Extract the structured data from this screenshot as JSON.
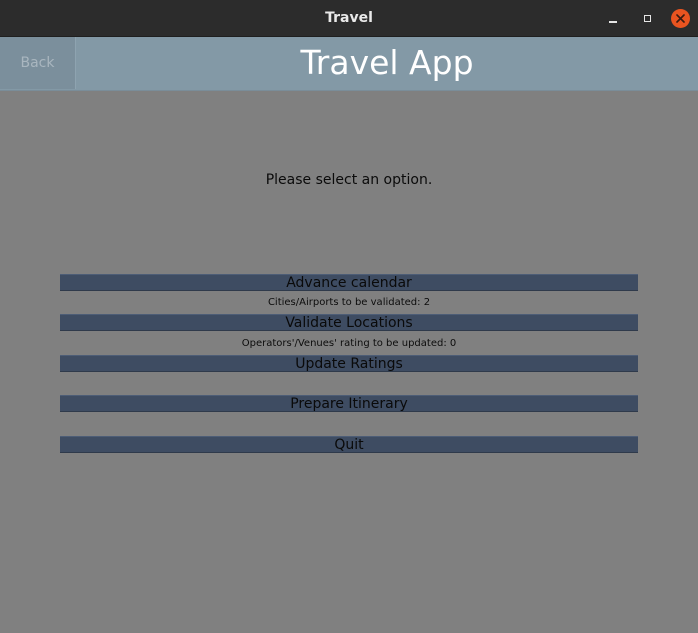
{
  "window": {
    "title": "Travel",
    "controls": {
      "minimize_icon": "minimize-icon",
      "maximize_icon": "maximize-icon",
      "close_icon": "close-icon"
    },
    "close_color": "#e95420"
  },
  "header": {
    "back_label": "Back",
    "app_title": "Travel App",
    "background": "#8399a6"
  },
  "main": {
    "prompt": "Please select an option.",
    "buttons": [
      {
        "label": "Advance calendar"
      },
      {
        "label": "Validate Locations"
      },
      {
        "label": "Update Ratings"
      },
      {
        "label": "Prepare Itinerary"
      },
      {
        "label": "Quit"
      }
    ],
    "notes": {
      "cities_to_validate": "Cities/Airports to be validated: 2",
      "ratings_to_update": "Operators'/Venues' rating to be updated: 0"
    },
    "button_color": "#3e4c62"
  }
}
